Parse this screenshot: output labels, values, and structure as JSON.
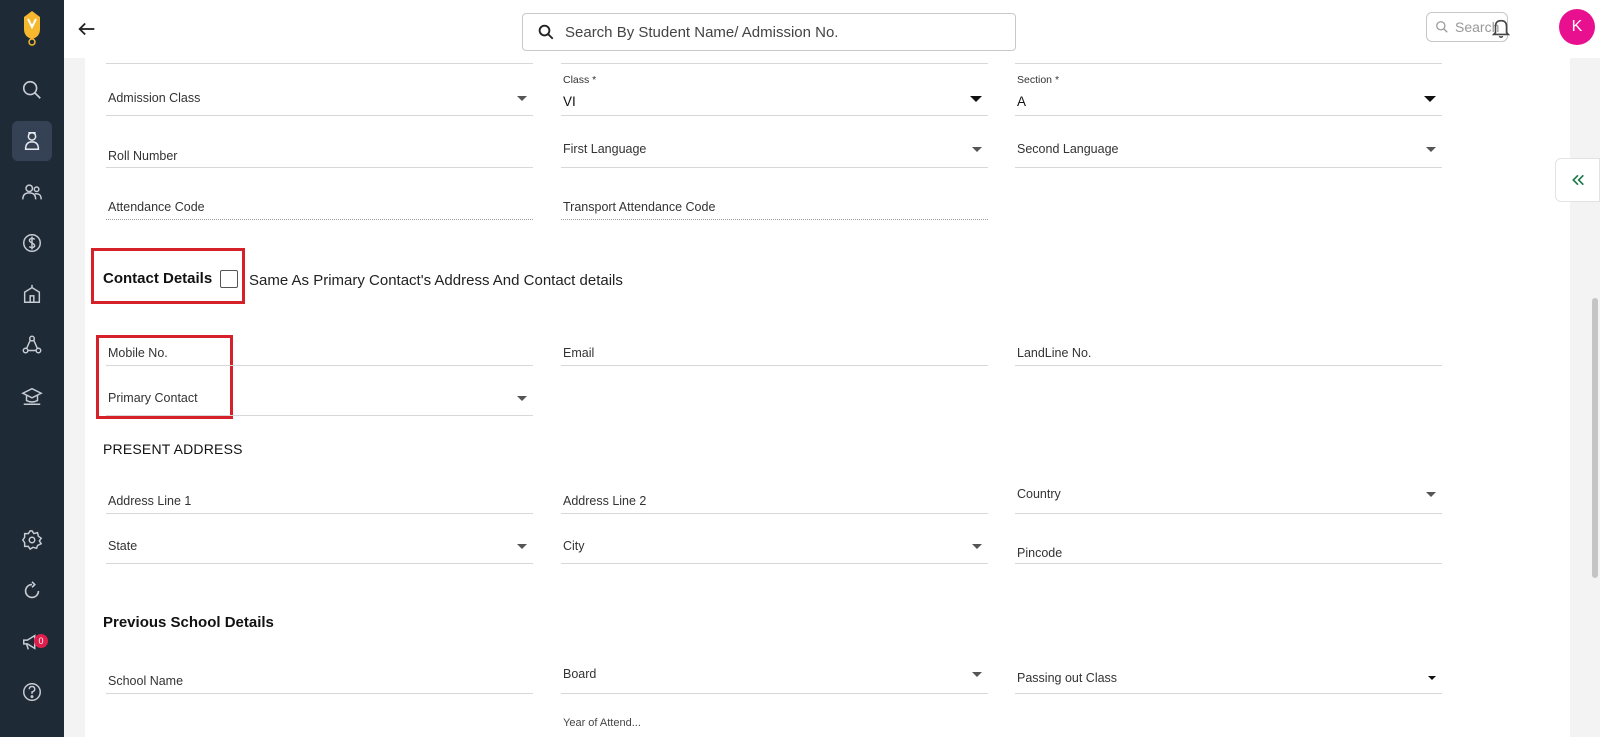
{
  "header": {
    "search_placeholder": "Search By Student Name/ Admission No.",
    "small_search_label": "Search",
    "avatar_initial": "K"
  },
  "sidebar": {
    "notification_count": "0",
    "items": [
      "search-icon",
      "student-icon",
      "people-icon",
      "fees-icon",
      "school-icon",
      "activities-icon",
      "academics-icon",
      "settings-icon",
      "sync-icon",
      "announcement-icon",
      "help-icon"
    ]
  },
  "form": {
    "admission_class": "Admission Class",
    "class_label": "Class *",
    "class_value": "VI",
    "section_label": "Section *",
    "section_value": "A",
    "roll_number": "Roll Number",
    "first_language": "First Language",
    "second_language": "Second Language",
    "attendance_code": "Attendance Code",
    "transport_attendance_code": "Transport Attendance Code"
  },
  "contact": {
    "title": "Contact Details",
    "same_as_label": "Same As Primary Contact's Address And Contact details",
    "mobile": "Mobile No.",
    "email": "Email",
    "landline": "LandLine No.",
    "primary_contact": "Primary Contact"
  },
  "address": {
    "title": "PRESENT ADDRESS",
    "line1": "Address Line 1",
    "line2": "Address Line 2",
    "country": "Country",
    "state": "State",
    "city": "City",
    "pincode": "Pincode"
  },
  "previous_school": {
    "title": "Previous School Details",
    "school_name": "School Name",
    "board": "Board",
    "passing_out_class": "Passing out Class",
    "year_partial": "Year of Attend..."
  },
  "colors": {
    "sidebar_bg": "#1f2a37",
    "accent_avatar": "#e9108f",
    "highlight_red": "#d6202a",
    "collapse_green": "#1e7a4c"
  }
}
